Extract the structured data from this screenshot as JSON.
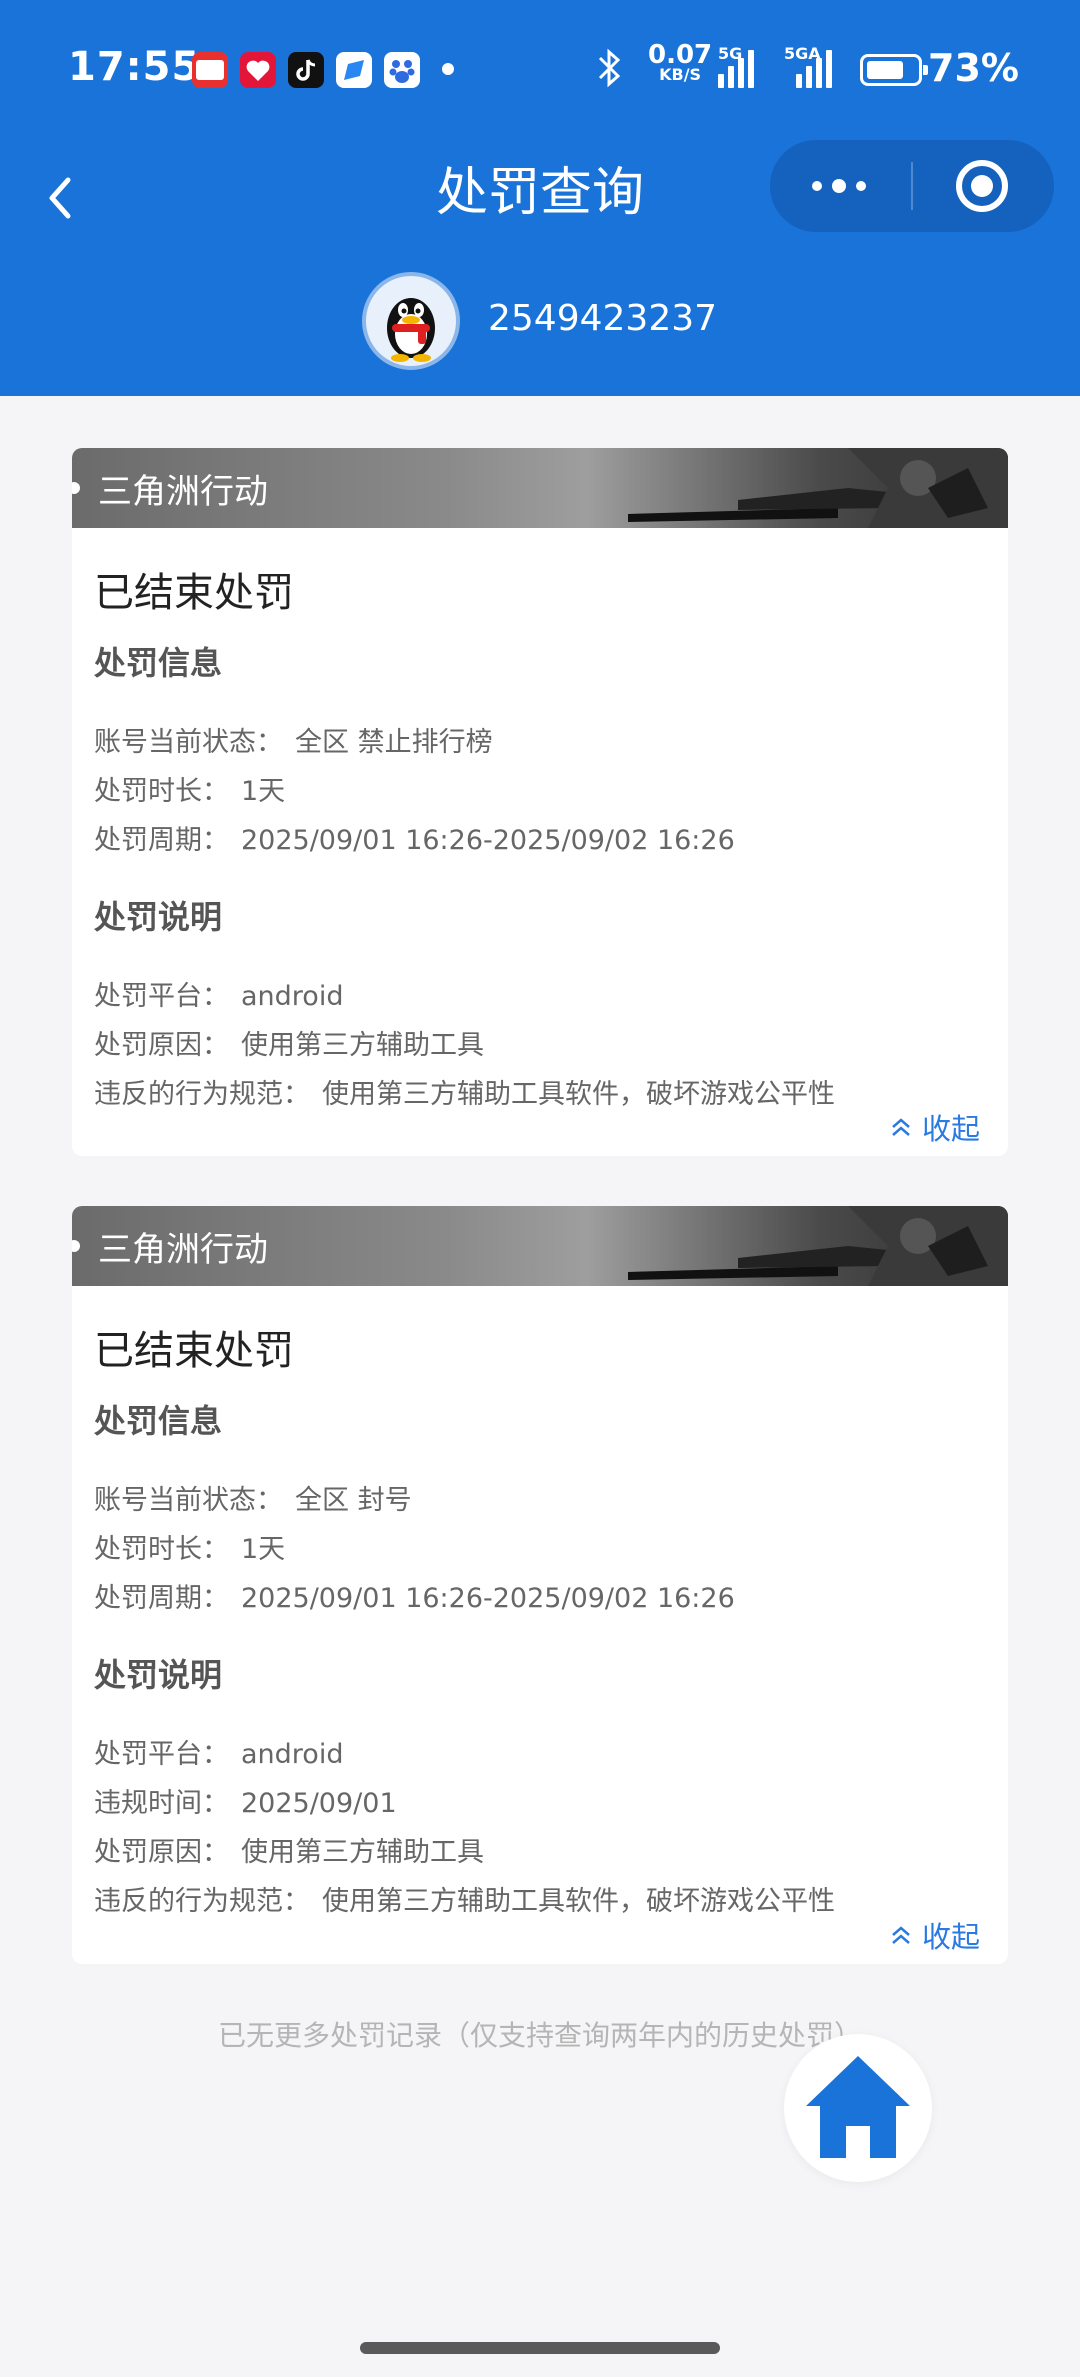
{
  "status_bar": {
    "time": "17:55",
    "net_speed": "0.07",
    "net_speed_unit": "KB/S",
    "sim1_label": "5G",
    "sim2_label": "5GA",
    "battery": "73%",
    "notification_icons": [
      "toutiao-app-icon",
      "heart-app-icon",
      "tiktok-app-icon",
      "browser-app-icon",
      "baidu-app-icon"
    ]
  },
  "nav": {
    "title": "处罚查询"
  },
  "user": {
    "qq_number": "2549423237"
  },
  "records": [
    {
      "game": "三角洲行动",
      "state": "已结束处罚",
      "info_title": "处罚信息",
      "info": [
        {
          "label": "账号当前状态：",
          "value": "全区 禁止排行榜"
        },
        {
          "label": "处罚时长：",
          "value": "1天"
        },
        {
          "label": "处罚周期：",
          "value": "2025/09/01 16:26-2025/09/02 16:26"
        }
      ],
      "desc_title": "处罚说明",
      "desc": [
        {
          "label": "处罚平台：",
          "value": "android"
        },
        {
          "label": "处罚原因：",
          "value": "使用第三方辅助工具"
        },
        {
          "label": "违反的行为规范：",
          "value": "使用第三方辅助工具软件，破坏游戏公平性"
        }
      ],
      "collapse_label": "收起"
    },
    {
      "game": "三角洲行动",
      "state": "已结束处罚",
      "info_title": "处罚信息",
      "info": [
        {
          "label": "账号当前状态：",
          "value": "全区 封号"
        },
        {
          "label": "处罚时长：",
          "value": "1天"
        },
        {
          "label": "处罚周期：",
          "value": "2025/09/01 16:26-2025/09/02 16:26"
        }
      ],
      "desc_title": "处罚说明",
      "desc": [
        {
          "label": "处罚平台：",
          "value": "android"
        },
        {
          "label": "违规时间：",
          "value": "2025/09/01"
        },
        {
          "label": "处罚原因：",
          "value": "使用第三方辅助工具"
        },
        {
          "label": "违反的行为规范：",
          "value": "使用第三方辅助工具软件，破坏游戏公平性"
        }
      ],
      "collapse_label": "收起"
    }
  ],
  "footer": {
    "end_note": "已无更多处罚记录（仅支持查询两年内的历史处罚）"
  },
  "colors": {
    "header_bg": "#1a73d9",
    "accent": "#2a7ae2",
    "page_bg": "#f5f5f7"
  }
}
